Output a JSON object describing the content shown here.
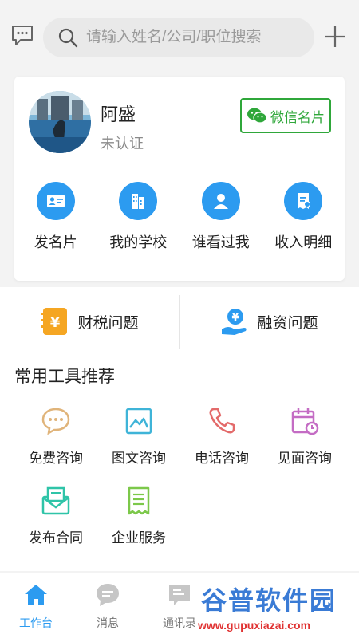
{
  "header": {
    "search_placeholder": "请输入姓名/公司/职位搜索",
    "icons": [
      "message-icon",
      "search-icon",
      "plus-icon"
    ]
  },
  "profile": {
    "name": "阿盛",
    "status": "未认证",
    "wechat_card_label": "微信名片"
  },
  "quick_actions": [
    {
      "label": "发名片",
      "icon": "business-card-icon"
    },
    {
      "label": "我的学校",
      "icon": "building-icon"
    },
    {
      "label": "谁看过我",
      "icon": "user-icon"
    },
    {
      "label": "收入明细",
      "icon": "bill-icon"
    }
  ],
  "consult": [
    {
      "label": "财税问题",
      "icon": "tax-icon"
    },
    {
      "label": "融资问题",
      "icon": "finance-icon"
    }
  ],
  "tools": {
    "title": "常用工具推荐",
    "items": [
      {
        "label": "免费咨询",
        "icon": "chat-bubble-icon"
      },
      {
        "label": "图文咨询",
        "icon": "image-icon"
      },
      {
        "label": "电话咨询",
        "icon": "phone-icon"
      },
      {
        "label": "见面咨询",
        "icon": "calendar-icon"
      },
      {
        "label": "发布合同",
        "icon": "contract-mail-icon"
      },
      {
        "label": "企业服务",
        "icon": "document-icon"
      }
    ]
  },
  "tabbar": [
    {
      "label": "工作台",
      "active": true
    },
    {
      "label": "消息",
      "active": false
    },
    {
      "label": "通讯录",
      "active": false
    }
  ],
  "watermark": {
    "cn": "谷普软件园",
    "url": "www.gupuxiazai.com"
  },
  "colors": {
    "accent": "#2c9bf0",
    "wechat_green": "#2fa73a",
    "background": "#f3f3f3"
  }
}
